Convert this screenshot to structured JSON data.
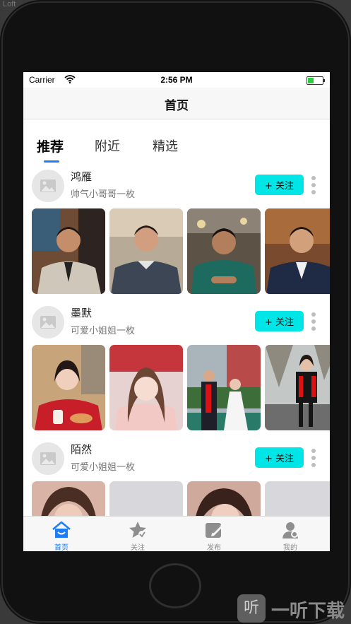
{
  "background": {
    "label": "Loft"
  },
  "status_bar": {
    "carrier": "Carrier",
    "time": "2:56 PM"
  },
  "nav": {
    "title": "首页"
  },
  "tabs": [
    {
      "label": "推荐",
      "active": true
    },
    {
      "label": "附近",
      "active": false
    },
    {
      "label": "精选",
      "active": false
    }
  ],
  "posts": [
    {
      "name": "鸿雁",
      "subtitle": "帅气小哥哥一枚",
      "follow_label": "+ 关注",
      "photo_count": 4
    },
    {
      "name": "墨默",
      "subtitle": "可爱小姐姐一枚",
      "follow_label": "+ 关注",
      "photo_count": 4
    },
    {
      "name": "陌然",
      "subtitle": "可爱小姐姐一枚",
      "follow_label": "+ 关注",
      "photo_count": 4
    }
  ],
  "tab_bar": [
    {
      "label": "首页",
      "icon": "home-icon",
      "active": true
    },
    {
      "label": "关注",
      "icon": "star-icon",
      "active": false
    },
    {
      "label": "发布",
      "icon": "compose-icon",
      "active": false
    },
    {
      "label": "我的",
      "icon": "person-icon",
      "active": false
    }
  ],
  "watermark": {
    "icon_glyph": "听",
    "text": "一听下载"
  },
  "colors": {
    "follow_button": "#00e5e5",
    "accent": "#1e7cf5",
    "battery": "#2ecc40"
  }
}
